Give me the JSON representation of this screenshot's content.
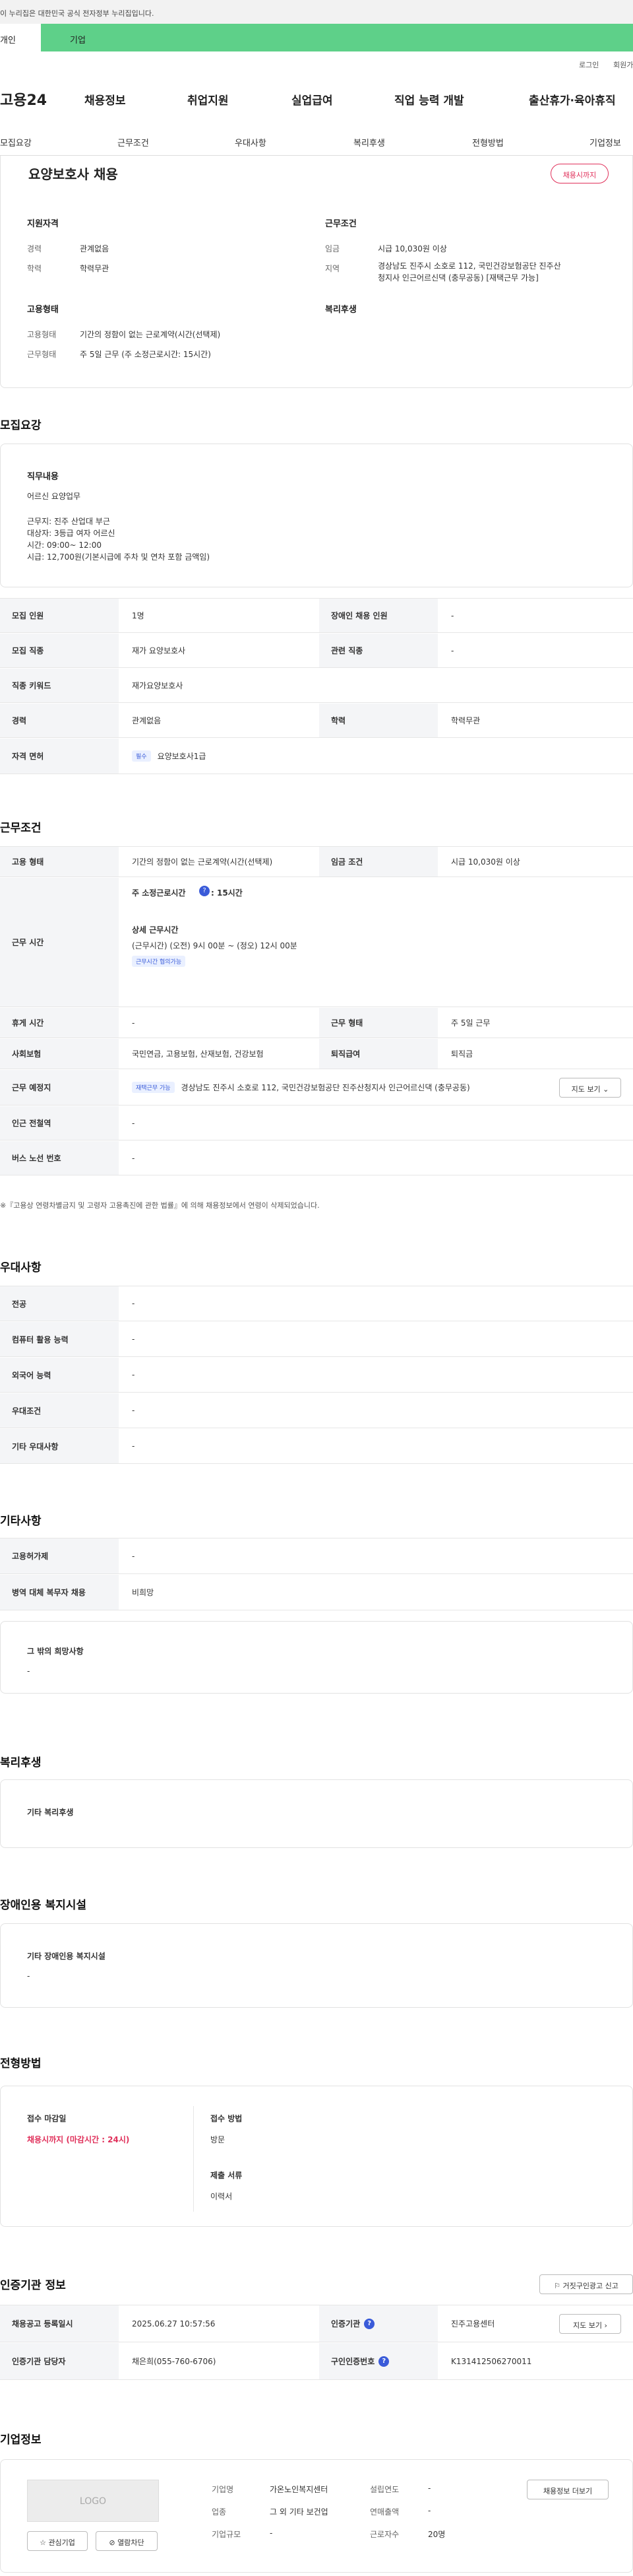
{
  "gov_notice": "이 누리집은 대한민국 공식 전자정부 누리집입니다.",
  "tabs": {
    "individual": "개인",
    "corporate": "기업"
  },
  "util": {
    "login": "로그인",
    "join": "회원가입"
  },
  "logo": "고용24",
  "gnb": [
    "채용정보",
    "취업지원",
    "실업급여",
    "직업 능력 개발",
    "출산휴가·육아휴직"
  ],
  "subnav": [
    "모집요강",
    "근무조건",
    "우대사항",
    "복리후생",
    "전형방법",
    "기업정보"
  ],
  "summary": {
    "title": "요양보호사 채용",
    "deadline_badge": "채용시까지",
    "qual_head": "지원자격",
    "career_k": "경력",
    "career_v": "관계없음",
    "edu_k": "학력",
    "edu_v": "학력무관",
    "cond_head": "근무조건",
    "wage_k": "임금",
    "wage_v": "시급 10,030원 이상",
    "loc_k": "지역",
    "loc_v1": "경상남도 진주시 소호로 112, 국민건강보험공단 진주산",
    "loc_v2": "청지사 인근어르신댁 (충무공동) [재택근무 가능]",
    "emp_head": "고용형태",
    "emp_k": "고용형태",
    "emp_v": "기간의 정함이 없는 근로계약(시간(선택제)",
    "work_k": "근무형태",
    "work_v": "주 5일 근무 (주 소정근로시간: 15시간)",
    "welfare_head": "복리후생"
  },
  "recruit": {
    "section": "모집요강",
    "duty_head": "직무내용",
    "duty_lines": [
      "어르신 요양업무",
      "",
      "근무지: 진주 산업대 부근",
      "대상자: 3등급 여자 어르신",
      "시간: 09:00~ 12:00",
      "시급: 12,700원(기본시급에 주차 및 연차 포함 금액임)"
    ],
    "rows": [
      {
        "k1": "모집 인원",
        "v1": "1명",
        "k2": "장애인 채용 인원",
        "v2": "-"
      },
      {
        "k1": "모집 직종",
        "v1": "재가 요양보호사",
        "k2": "관련 직종",
        "v2": "-"
      },
      {
        "k1": "직종 키워드",
        "v1": "재가요양보호사"
      },
      {
        "k1": "경력",
        "v1": "관계없음",
        "k2": "학력",
        "v2": "학력무관"
      },
      {
        "k1": "자격 면허",
        "badge": "필수",
        "v1": "요양보호사1급"
      }
    ]
  },
  "work": {
    "section": "근무조건",
    "emp_k": "고용 형태",
    "emp_v": "기간의 정함이 없는 근로계약(시간(선택제)",
    "wage_k": "임금 조건",
    "wage_v": "시급 10,030원 이상",
    "time_k": "근무 시간",
    "weekly": "주 소정근로시간",
    "weekly_v": ": 15시간",
    "detail_head": "상세 근무시간",
    "detail_v1": "(근무시간) (오전) 9시 00분 ~ (정오) 12시 00분",
    "detail_badge": "근무시간 협의가능",
    "rest_k": "휴게 시간",
    "rest_v": "-",
    "form_k": "근무 형태",
    "form_v": "주 5일 근무",
    "ins_k": "사회보험",
    "ins_v": "국민연금, 고용보험, 산재보험, 건강보험",
    "ret_k": "퇴직급여",
    "ret_v": "퇴직금",
    "place_k": "근무 예정지",
    "place_badge": "재택근무 가능",
    "place_v": "경상남도 진주시 소호로 112, 국민건강보험공단 진주산청지사 인근어르신댁 (충무공동)",
    "map_btn": "지도 보기",
    "subway_k": "인근 전철역",
    "subway_v": "-",
    "bus_k": "버스 노선 번호",
    "bus_v": "-",
    "note": "※『고용상 연령차별금지 및 고령자 고용촉진에 관한 법률』에 의해 채용정보에서 연령이 삭제되었습니다."
  },
  "pref": {
    "section": "우대사항",
    "rows": [
      {
        "k": "전공",
        "v": "-"
      },
      {
        "k": "컴퓨터 활용 능력",
        "v": "-"
      },
      {
        "k": "외국어 능력",
        "v": "-"
      },
      {
        "k": "우대조건",
        "v": "-"
      },
      {
        "k": "기타 우대사항",
        "v": "-"
      }
    ]
  },
  "etc": {
    "section": "기타사항",
    "rows": [
      {
        "k": "고용허가제",
        "v": "-"
      },
      {
        "k": "병역 대체 복무자 채용",
        "v": "비희망"
      }
    ],
    "hope_head": "그 밖의 희망사항",
    "hope_v": "-"
  },
  "welfare": {
    "section": "복리후생",
    "other": "기타 복리후생"
  },
  "disab": {
    "section": "장애인용 복지시설",
    "other": "기타 장애인용 복지시설",
    "v": "-"
  },
  "process": {
    "section": "전형방법",
    "deadline_head": "접수 마감일",
    "deadline_v": "채용시까지 (마감시간 : 24시)",
    "method_head": "접수 방법",
    "method_v": "방문",
    "docs_head": "제출 서류",
    "docs_v": "이력서"
  },
  "agency": {
    "section": "인증기관 정보",
    "report_btn": "거짓구인광고 신고",
    "reg_k": "채용공고 등록일시",
    "reg_v": "2025.06.27 10:57:56",
    "org_k": "인증기관",
    "org_v": "진주고용센터",
    "map_btn": "지도 보기",
    "mgr_k": "인증기관 담당자",
    "mgr_v": "채은희(055-760-6706)",
    "no_k": "구인인증번호",
    "no_v": "K131412506270011"
  },
  "company": {
    "section": "기업정보",
    "logo": "LOGO",
    "fav_btn": "관심기업",
    "block_btn": "열람차단",
    "info_btn": "채용정보 더보기",
    "name_k": "기업명",
    "name_v": "가온노인복지센터",
    "year_k": "설립연도",
    "year_v": "-",
    "ind_k": "업종",
    "ind_v": "그 외 기타 보건업",
    "sales_k": "연매출액",
    "sales_v": "-",
    "size_k": "기업규모",
    "size_v": "-",
    "staff_k": "근로자수",
    "staff_v": "20명"
  }
}
